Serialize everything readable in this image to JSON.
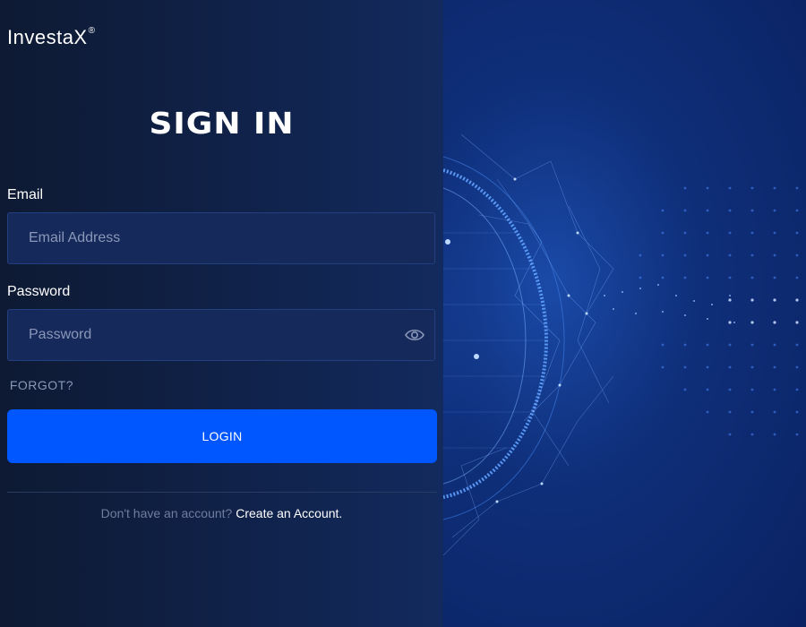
{
  "brand": {
    "name": "InvestaX",
    "mark": "®"
  },
  "title": "SIGN IN",
  "form": {
    "email_label": "Email",
    "email_placeholder": "Email Address",
    "email_value": "",
    "password_label": "Password",
    "password_placeholder": "Password",
    "password_value": "",
    "toggle_icon": "eye-icon",
    "forgot_label": "FORGOT?",
    "login_label": "LOGIN"
  },
  "footer": {
    "prompt": "Don't have an account?",
    "link": "Create an Account."
  },
  "colors": {
    "accent": "#0057ff",
    "panel_bg": "#0e1a33",
    "right_bg": "#0f2f7a"
  }
}
